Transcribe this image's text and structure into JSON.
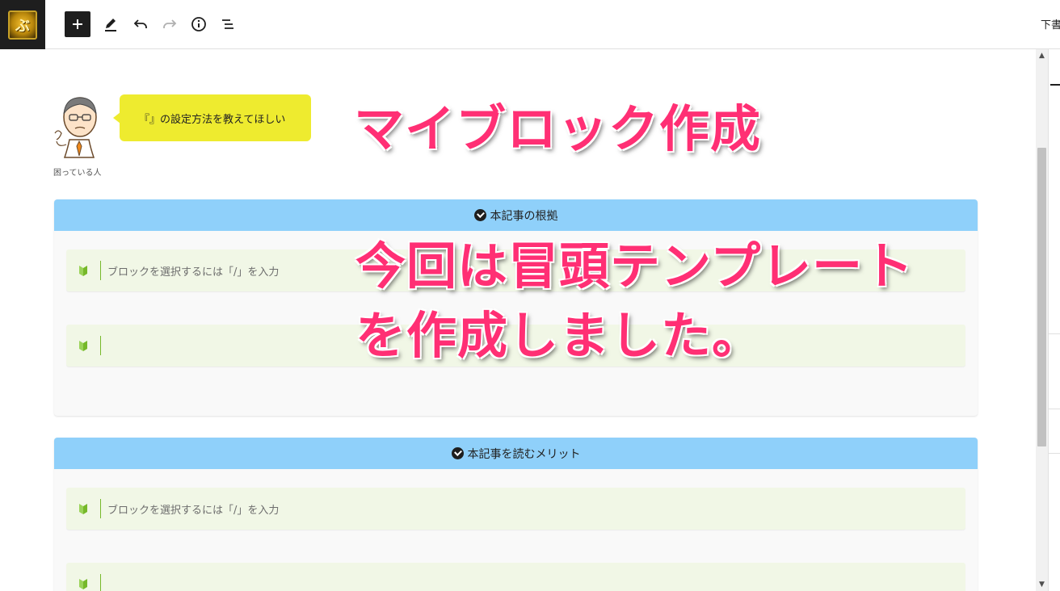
{
  "toolbar": {
    "logo_glyph": "ぶ",
    "draft_label": "下書き保存"
  },
  "balloon": {
    "speaker_name": "困っている人",
    "text": "『』の設定方法を教えてほしい"
  },
  "overlay": {
    "line1": "マイブロック作成",
    "line2": "今回は冒頭テンプレート",
    "line3": "を作成しました。",
    "color": "#ff2f74"
  },
  "boxes": [
    {
      "title": "本記事の根拠",
      "items": [
        {
          "placeholder": "ブロックを選択するには「/」を入力"
        },
        {
          "placeholder": ""
        }
      ]
    },
    {
      "title": "本記事を読むメリット",
      "items": [
        {
          "placeholder": "ブロックを選択するには「/」を入力"
        },
        {
          "placeholder": ""
        }
      ]
    }
  ],
  "colors": {
    "caption_header": "#8fd0fa",
    "point_bg": "#f1f7e6",
    "point_accent": "#76b82a",
    "balloon_bg": "#eeeb2f"
  }
}
